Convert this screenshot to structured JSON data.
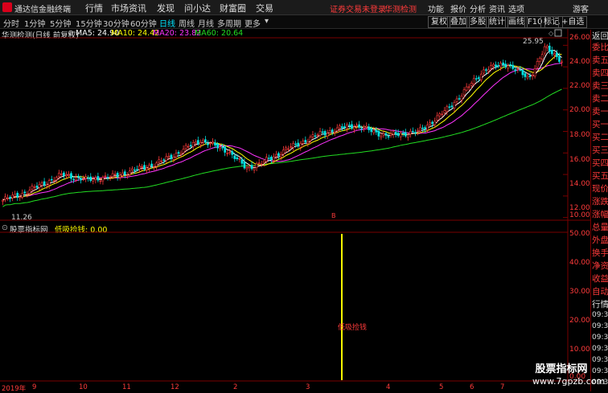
{
  "titlebar": {
    "app_title": "通达信金融终端",
    "menus": [
      "行情",
      "市场",
      "资讯",
      "发现",
      "问小达",
      "财富圈",
      "交易"
    ],
    "notice": "证券交易未登录",
    "notice_link": "华测检测",
    "right_menus": [
      "功能",
      "报价",
      "分析",
      "资讯",
      "选项"
    ],
    "user": "游客"
  },
  "periodbar": {
    "periods": [
      "分时",
      "1分钟",
      "5分钟",
      "15分钟",
      "30分钟",
      "60分钟",
      "日线",
      "周线",
      "月线",
      "多周期",
      "更多"
    ],
    "active_period": "日线",
    "tools": [
      "复权",
      "叠加",
      "多股",
      "统计",
      "画线",
      "F10",
      "标记",
      "+自选",
      "返回"
    ]
  },
  "main_chart": {
    "stock_label": "华测检测(日线 前复权)",
    "ma_legend": [
      {
        "name": "MA5",
        "value": "24.90",
        "color": "#ffffff"
      },
      {
        "name": "MA10",
        "value": "24.42",
        "color": "#ffff00"
      },
      {
        "name": "MA20",
        "value": "23.82",
        "color": "#ff33ff"
      },
      {
        "name": "MA60",
        "value": "20.64",
        "color": "#22dd22"
      }
    ],
    "high_label": "25.95",
    "low_label": "11.26",
    "y_ticks": [
      "26.00",
      "24.00",
      "22.00",
      "20.00",
      "18.00",
      "16.00",
      "14.00",
      "12.00",
      "10.00"
    ],
    "marker": "B"
  },
  "indicator_chart": {
    "source": "股票指标网",
    "name": "低吸捡钱",
    "value": "0.00",
    "signal_label": "低吸捡钱",
    "y_ticks": [
      "50.00",
      "40.00",
      "30.00",
      "20.00",
      "10.00",
      "0.00"
    ]
  },
  "x_axis": {
    "year": "2019年",
    "months": [
      "9",
      "10",
      "11",
      "12",
      "2",
      "3",
      "4",
      "5",
      "6",
      "7"
    ]
  },
  "right_panel": {
    "items": [
      "委比",
      "卖五",
      "卖四",
      "卖三",
      "卖二",
      "卖一",
      "买一",
      "买二",
      "买三",
      "买四",
      "买五",
      "现价",
      "涨跌",
      "涨幅",
      "总量",
      "外盘",
      "换手",
      "净资",
      "收益"
    ],
    "auto_label": "自动",
    "quote_label": "行情",
    "times": [
      "09:30",
      "09:30",
      "09:30",
      "09:30",
      "09:30",
      "09:30",
      "09:30",
      "09:30",
      "09:30",
      "09:30",
      "09:30"
    ]
  },
  "watermark": {
    "line1": "股票指标网",
    "line2": "www.7gpzb.com"
  },
  "colors": {
    "up": "#ff3b3b",
    "down": "#00e0e0",
    "ma5": "#ffffff",
    "ma10": "#ffff00",
    "ma20": "#ff33ff",
    "ma60": "#22dd22",
    "accent": "#00e5ff",
    "signal_bar": "#ffff00"
  }
}
